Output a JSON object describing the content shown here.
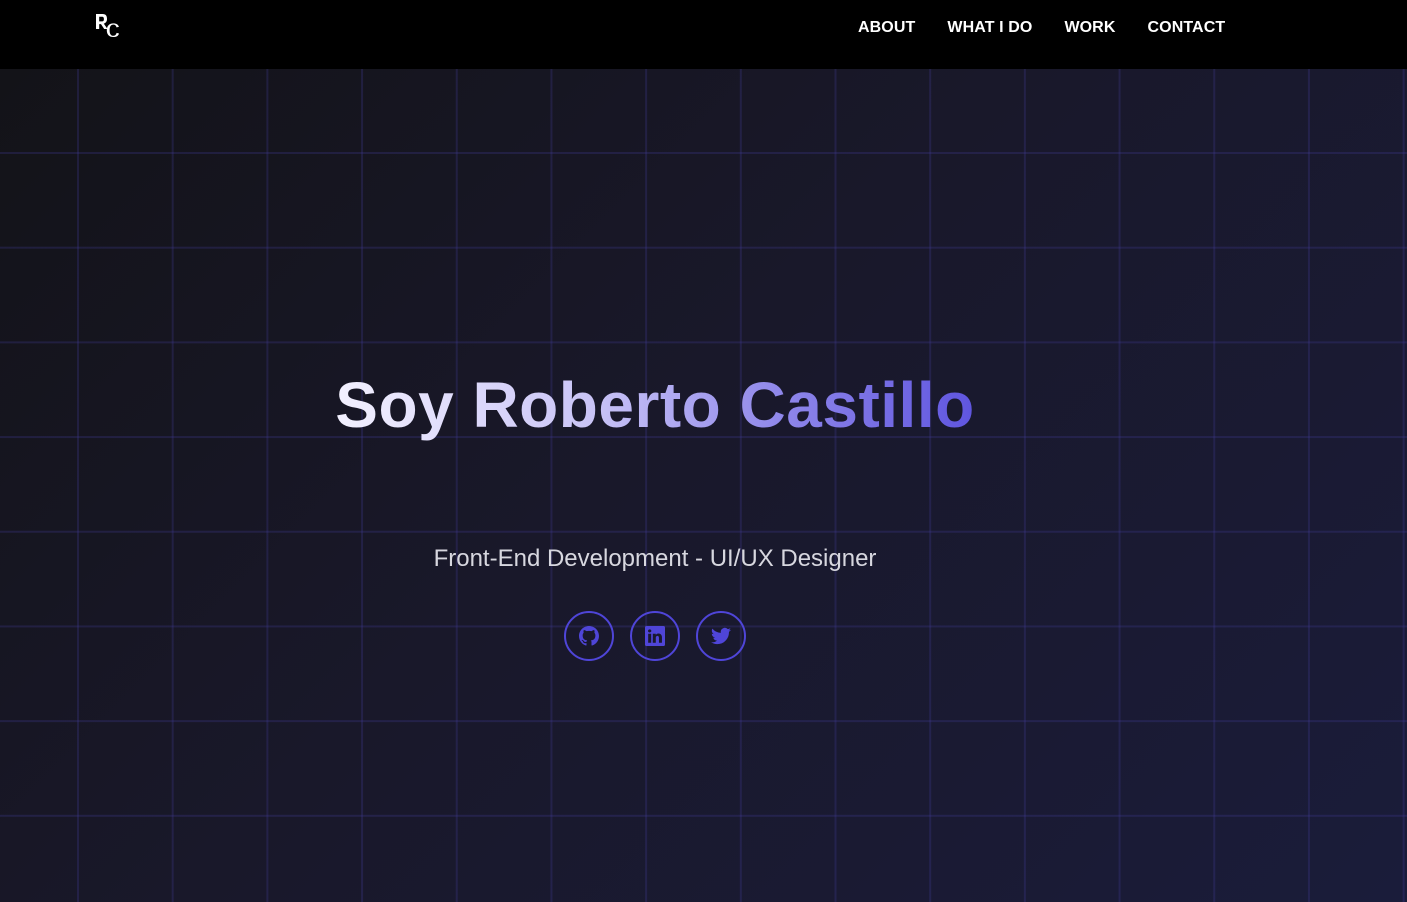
{
  "nav": {
    "logo_text": "RC",
    "links": [
      "ABOUT",
      "WHAT I DO",
      "WORK",
      "CONTACT"
    ]
  },
  "hero": {
    "title": "Soy Roberto Castillo",
    "subtitle": "Front-End Development - UI/UX Designer",
    "socials": [
      {
        "icon": "github-icon"
      },
      {
        "icon": "linkedin-icon"
      },
      {
        "icon": "twitter-icon"
      }
    ]
  },
  "colors": {
    "background": "#000000",
    "accent": "#4f45d8",
    "grid_line": "#403a96",
    "nav_text": "#ffffff",
    "subtitle_text": "#d7d7df"
  }
}
